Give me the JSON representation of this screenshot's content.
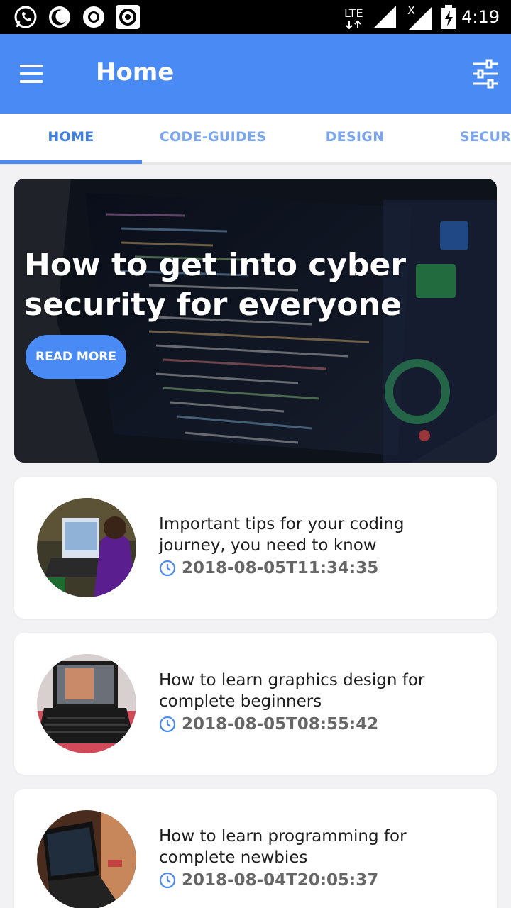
{
  "status_bar": {
    "time": "4:19",
    "network": "LTE",
    "icons": [
      "whatsapp-icon",
      "night-mode-icon",
      "record-icon",
      "target-icon",
      "signal-icon",
      "no-signal-icon",
      "battery-charging-icon"
    ]
  },
  "app_bar": {
    "title": "Home",
    "menu_icon": "menu-icon",
    "filter_icon": "filter-icon"
  },
  "tabs": [
    {
      "label": "HOME",
      "active": true
    },
    {
      "label": "CODE-GUIDES",
      "active": false
    },
    {
      "label": "DESIGN",
      "active": false
    },
    {
      "label": "SECUR",
      "active": false
    }
  ],
  "hero": {
    "title": "How to get into cyber security for everyone",
    "button_label": "READ MORE"
  },
  "posts": [
    {
      "title": "Important tips for your coding journey, you need to know",
      "date": "2018-08-05T11:34:35"
    },
    {
      "title": "How to learn graphics design for complete beginners",
      "date": "2018-08-05T08:55:42"
    },
    {
      "title": "How to learn programming for complete newbies",
      "date": "2018-08-04T20:05:37"
    }
  ],
  "colors": {
    "primary": "#4a8af4",
    "tab_active": "#3f7fe6",
    "tab_inactive": "#7aa6f0",
    "background": "#f2f2f4"
  }
}
